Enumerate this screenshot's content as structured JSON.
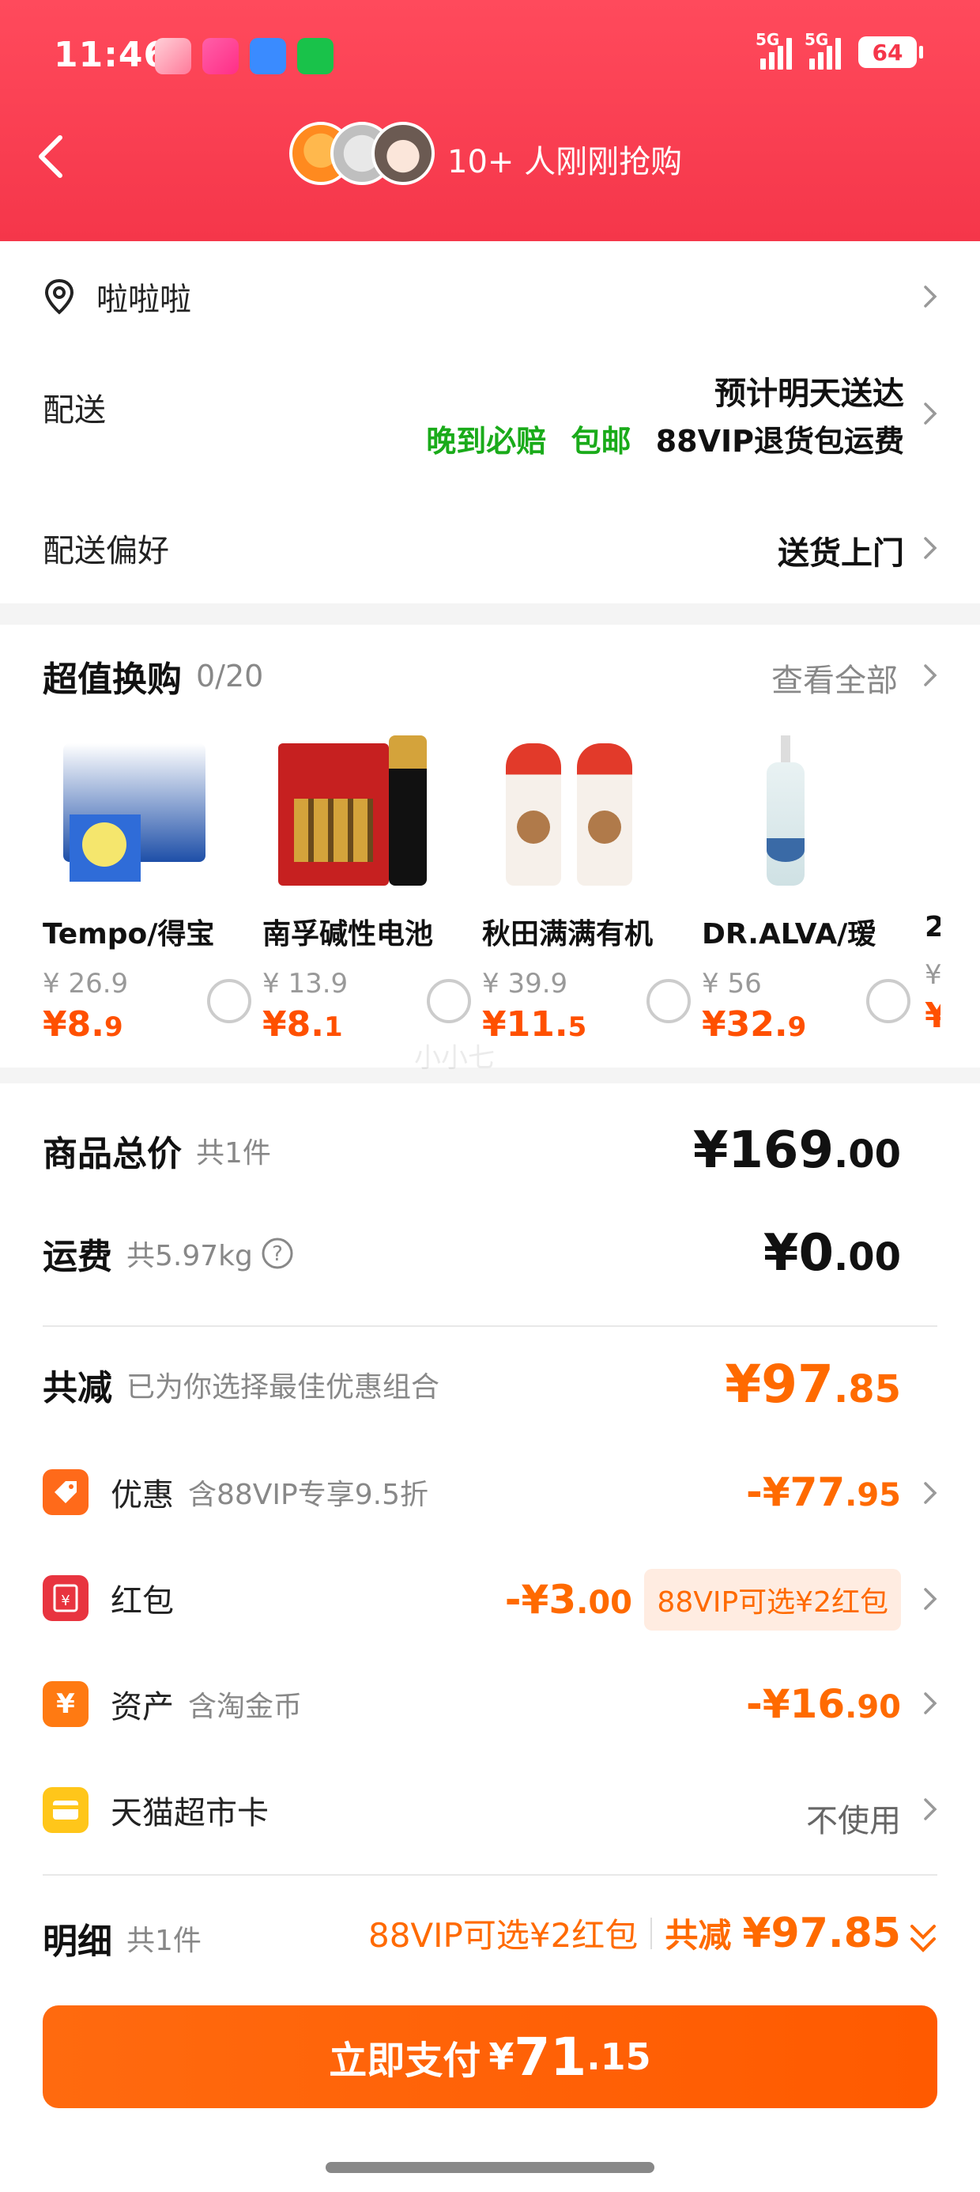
{
  "status": {
    "time": "11:46",
    "net1": "5G",
    "net2": "5G",
    "battery": "64"
  },
  "header": {
    "hot_text": "10+ 人刚刚抢购"
  },
  "address": {
    "name": "啦啦啦"
  },
  "delivery": {
    "label": "配送",
    "eta": "预计明天送达",
    "tag_late": "晚到必赔",
    "tag_free": "包邮",
    "tag_vip": "88VIP退货包运费"
  },
  "preference": {
    "label": "配送偏好",
    "value": "送货上门"
  },
  "exchange": {
    "title": "超值换购",
    "count": "0/20",
    "view_all": "查看全部",
    "products": [
      {
        "name": "Tempo/得宝",
        "orig": "¥ 26.9",
        "price_int": "¥8.",
        "price_dec": "9"
      },
      {
        "name": "南孚碱性电池",
        "orig": "¥ 13.9",
        "price_int": "¥8.",
        "price_dec": "1"
      },
      {
        "name": "秋田满满有机",
        "orig": "¥ 39.9",
        "price_int": "¥11.",
        "price_dec": "5"
      },
      {
        "name": "DR.ALVA/瑷",
        "orig": "¥ 56",
        "price_int": "¥32.",
        "price_dec": "9"
      },
      {
        "name": "2",
        "orig": "¥",
        "price_int": "¥",
        "price_dec": ""
      }
    ]
  },
  "watermark": "小小七",
  "summary": {
    "total_label": "商品总价",
    "total_sub": "共1件",
    "total_int": "¥169",
    "total_dec": ".00",
    "freight_label": "运费",
    "freight_sub": "共5.97kg",
    "freight_int": "¥0",
    "freight_dec": ".00",
    "reduce_label": "共减",
    "reduce_sub": "已为你选择最佳优惠组合",
    "reduce_int": "¥97",
    "reduce_dec": ".85",
    "discount_label": "优惠",
    "discount_sub": "含88VIP专享9.5折",
    "discount_int": "-¥77",
    "discount_dec": ".95",
    "redpacket_label": "红包",
    "redpacket_int": "-¥3",
    "redpacket_dec": ".00",
    "redpacket_badge": "88VIP可选¥2红包",
    "asset_label": "资产",
    "asset_sub": "含淘金币",
    "asset_int": "-¥16",
    "asset_dec": ".90",
    "card_label": "天猫超市卡",
    "card_value": "不使用"
  },
  "detail": {
    "label": "明细",
    "sub": "共1件",
    "vip": "88VIP可选¥2红包",
    "reduce": "共减",
    "reduce_amt": "¥97.85"
  },
  "pay": {
    "label": "立即支付",
    "currency": "¥",
    "int": "71",
    "dec": ".15"
  },
  "colors": {
    "header": "#f5364a",
    "accent": "#ff6a00",
    "green": "#1aab1a"
  }
}
